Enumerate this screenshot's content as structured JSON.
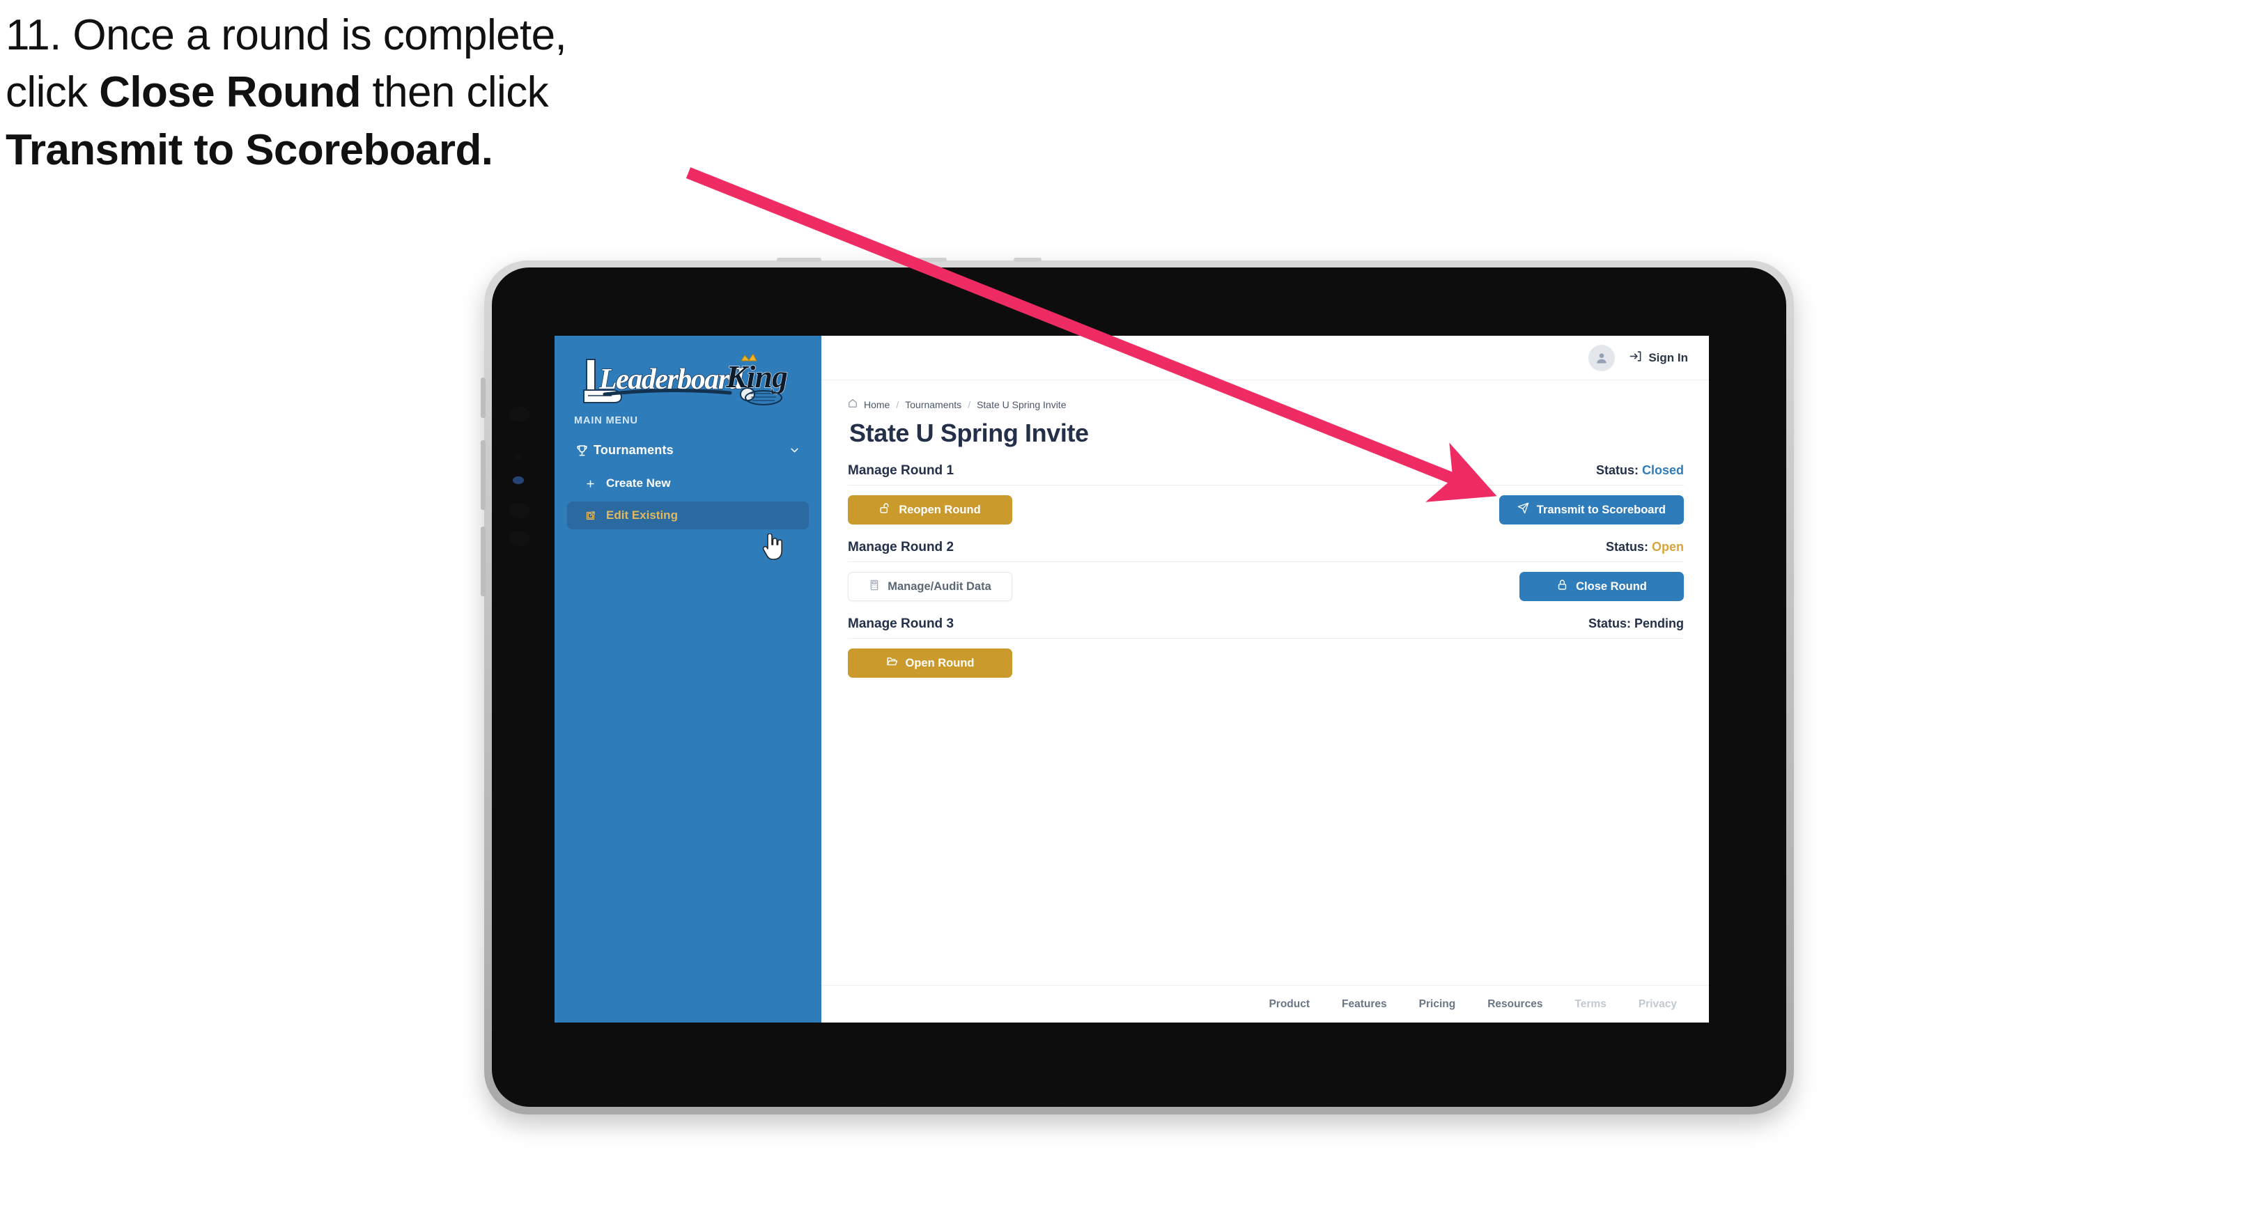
{
  "instruction": {
    "line1": "11. Once a round is complete,",
    "line2_pre": "click ",
    "line2_bold": "Close Round",
    "line2_post": " then click",
    "line3_bold": "Transmit to Scoreboard."
  },
  "colors": {
    "brand_blue": "#2F7CBB",
    "brand_gold": "#CA9A2C",
    "sidebar_blue": "#2F7CBB",
    "sidebar_active": "#2A6AA0",
    "status_closed": "#2F7CBB",
    "status_open": "#D9A43A",
    "status_pending": "#24304A",
    "arrow_pink": "#EE2B63",
    "title_navy": "#24304A"
  },
  "sidebar": {
    "logo_text_primary": "Leaderboard",
    "logo_text_secondary": "King",
    "section_label": "MAIN MENU",
    "nav": [
      {
        "label": "Tournaments",
        "icon": "trophy-icon",
        "caret": "chevron-down-icon"
      }
    ],
    "sub_items": [
      {
        "label": "Create New",
        "icon": "plus-icon",
        "active": false
      },
      {
        "label": "Edit Existing",
        "icon": "pencil-square-icon",
        "active": true
      }
    ]
  },
  "topbar": {
    "avatar_icon": "user-avatar-icon",
    "signin_label": "Sign In",
    "signin_icon": "login-arrow-icon"
  },
  "breadcrumb": {
    "home_icon": "home-icon",
    "items": [
      "Home",
      "Tournaments",
      "State U Spring Invite"
    ],
    "separator": "/"
  },
  "page": {
    "title": "State U Spring Invite"
  },
  "rounds": [
    {
      "name": "Manage Round 1",
      "status_label": "Status:",
      "status_value": "Closed",
      "status_kind": "closed",
      "left_button": {
        "label": "Reopen Round",
        "icon": "unlock-icon",
        "style": "gold"
      },
      "right_button": {
        "label": "Transmit to Scoreboard",
        "icon": "paper-plane-icon",
        "style": "blue"
      }
    },
    {
      "name": "Manage Round 2",
      "status_label": "Status:",
      "status_value": "Open",
      "status_kind": "open",
      "left_button": {
        "label": "Manage/Audit Data",
        "icon": "calculator-icon",
        "style": "light"
      },
      "right_button": {
        "label": "Close Round",
        "icon": "lock-icon",
        "style": "blue"
      }
    },
    {
      "name": "Manage Round 3",
      "status_label": "Status:",
      "status_value": "Pending",
      "status_kind": "pending",
      "left_button": {
        "label": "Open Round",
        "icon": "open-folder-icon",
        "style": "gold"
      },
      "right_button": null
    }
  ],
  "footer": {
    "links": [
      {
        "label": "Product",
        "dim": false
      },
      {
        "label": "Features",
        "dim": false
      },
      {
        "label": "Pricing",
        "dim": false
      },
      {
        "label": "Resources",
        "dim": false
      },
      {
        "label": "Terms",
        "dim": true
      },
      {
        "label": "Privacy",
        "dim": true
      }
    ]
  },
  "annotation": {
    "arrow_icon": "pointer-arrow-icon",
    "cursor_icon": "hand-cursor-icon"
  }
}
